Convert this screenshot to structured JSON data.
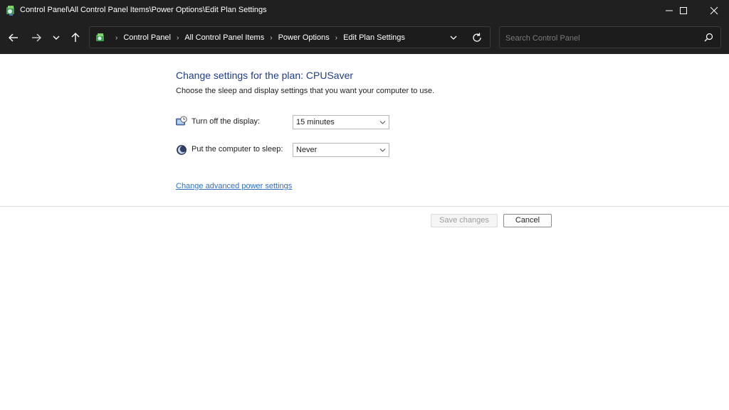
{
  "window": {
    "title": "Control Panel\\All Control Panel Items\\Power Options\\Edit Plan Settings",
    "icon": "control-panel-icon"
  },
  "nav": {
    "breadcrumbs": [
      "Control Panel",
      "All Control Panel Items",
      "Power Options",
      "Edit Plan Settings"
    ],
    "search_placeholder": "Search Control Panel"
  },
  "main": {
    "heading": "Change settings for the plan: CPUSaver",
    "subtext": "Choose the sleep and display settings that you want your computer to use.",
    "settings": [
      {
        "label": "Turn off the display:",
        "value": "15 minutes",
        "icon": "display-timer-icon"
      },
      {
        "label": "Put the computer to sleep:",
        "value": "Never",
        "icon": "sleep-moon-icon"
      }
    ],
    "advanced_link": "Change advanced power settings"
  },
  "actions": {
    "save_label": "Save changes",
    "cancel_label": "Cancel"
  },
  "colors": {
    "titlebar_bg": "#202020",
    "heading": "#1e3d8c",
    "link": "#2f6fc7"
  }
}
